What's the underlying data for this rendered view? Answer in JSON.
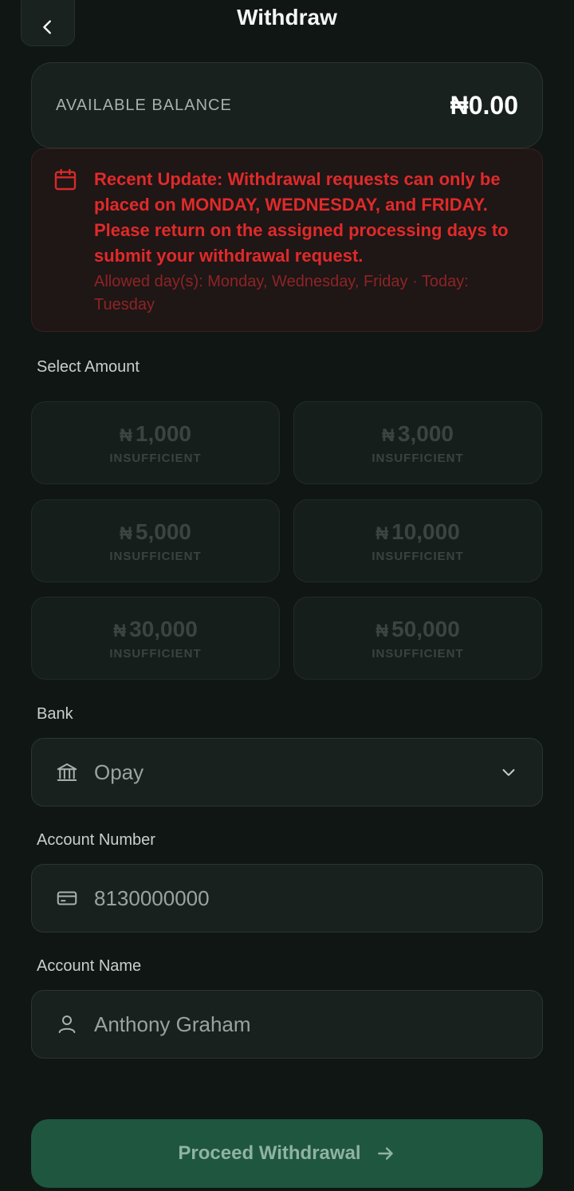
{
  "header": {
    "title": "Withdraw"
  },
  "balance": {
    "label": "AVAILABLE BALANCE",
    "value": "₦0.00"
  },
  "notice": {
    "title": "Recent Update: Withdrawal requests can only be placed on MONDAY, WEDNESDAY, and FRIDAY. Please return on the assigned processing days to submit your withdrawal request.",
    "subtitle": "Allowed day(s): Monday, Wednesday, Friday · Today: Tuesday",
    "color": "#e02a2a"
  },
  "amounts": {
    "label": "Select Amount",
    "currency": "₦",
    "items": [
      {
        "value": "1,000",
        "status": "INSUFFICIENT"
      },
      {
        "value": "3,000",
        "status": "INSUFFICIENT"
      },
      {
        "value": "5,000",
        "status": "INSUFFICIENT"
      },
      {
        "value": "10,000",
        "status": "INSUFFICIENT"
      },
      {
        "value": "30,000",
        "status": "INSUFFICIENT"
      },
      {
        "value": "50,000",
        "status": "INSUFFICIENT"
      }
    ]
  },
  "bank": {
    "label": "Bank",
    "value": "Opay",
    "icon": "bank-icon"
  },
  "account_number": {
    "label": "Account Number",
    "value": "8130000000",
    "icon": "card-icon"
  },
  "account_name": {
    "label": "Account Name",
    "value": "Anthony Graham",
    "icon": "user-icon"
  },
  "submit": {
    "label": "Proceed Withdrawal",
    "color": "#1f5640"
  }
}
